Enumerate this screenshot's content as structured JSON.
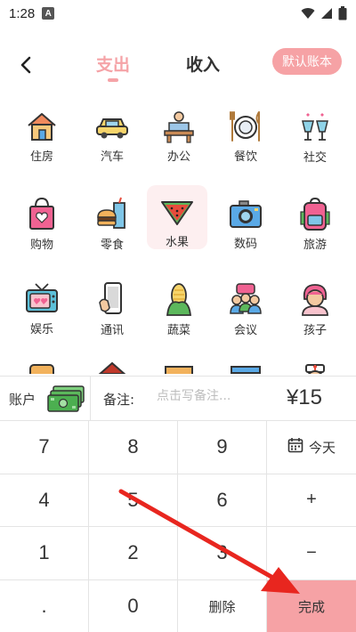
{
  "status_bar": {
    "time": "1:28",
    "notification_glyph": "A"
  },
  "header": {
    "tab_expense": "支出",
    "tab_income": "收入",
    "default_ledger_button": "默认账本"
  },
  "categories": [
    {
      "label": "住房",
      "icon": "house-icon"
    },
    {
      "label": "汽车",
      "icon": "car-icon"
    },
    {
      "label": "办公",
      "icon": "office-icon"
    },
    {
      "label": "餐饮",
      "icon": "dining-icon"
    },
    {
      "label": "社交",
      "icon": "social-icon"
    },
    {
      "label": "购物",
      "icon": "shopping-bag-icon"
    },
    {
      "label": "零食",
      "icon": "snack-icon"
    },
    {
      "label": "水果",
      "icon": "watermelon-icon",
      "selected": true
    },
    {
      "label": "数码",
      "icon": "camera-icon"
    },
    {
      "label": "旅游",
      "icon": "backpack-icon"
    },
    {
      "label": "娱乐",
      "icon": "tv-icon"
    },
    {
      "label": "通讯",
      "icon": "phone-icon"
    },
    {
      "label": "蔬菜",
      "icon": "corn-icon"
    },
    {
      "label": "会议",
      "icon": "meeting-icon"
    },
    {
      "label": "孩子",
      "icon": "child-icon"
    }
  ],
  "input_row": {
    "account_label": "账户",
    "note_label": "备注:",
    "note_placeholder": "点击写备注...",
    "amount": "¥15"
  },
  "keypad": {
    "k7": "7",
    "k8": "8",
    "k9": "9",
    "today": "今天",
    "k4": "4",
    "k5": "5",
    "k6": "6",
    "plus": "+",
    "k1": "1",
    "k2": "2",
    "k3": "3",
    "minus": "−",
    "dot": ".",
    "k0": "0",
    "delete": "删除",
    "done": "完成"
  },
  "colors": {
    "accent": "#f6a2a5",
    "selected_bg": "#fdeff0",
    "arrow": "#e8261f"
  }
}
